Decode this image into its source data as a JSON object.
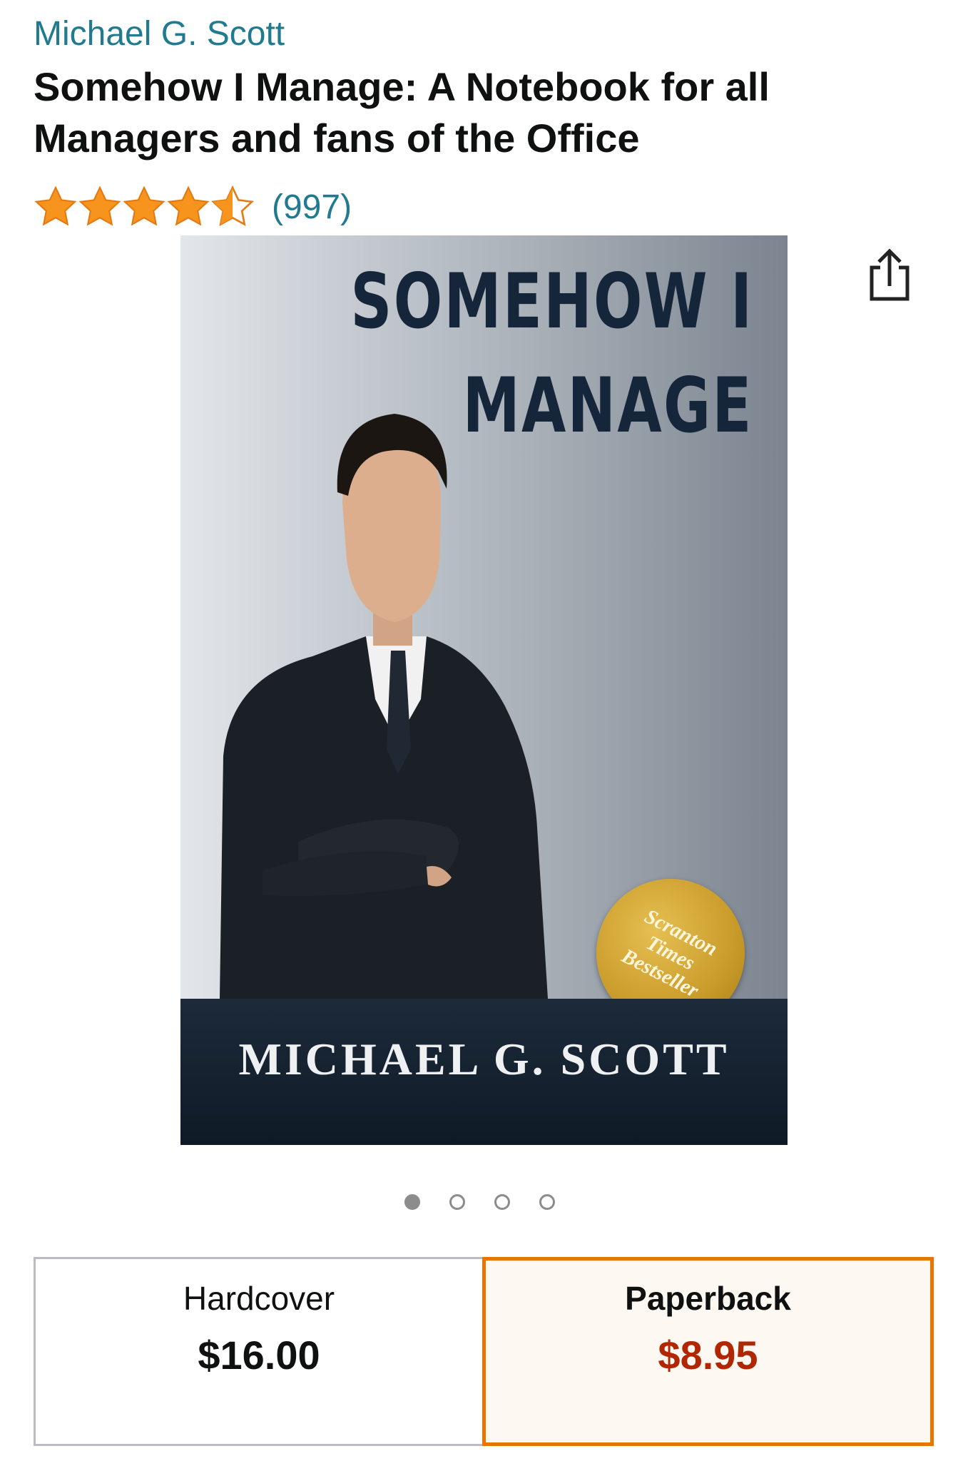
{
  "product": {
    "author": "Michael G. Scott",
    "title": "Somehow I Manage: A Notebook for all Managers and fans of the Office",
    "rating_value": 4.5,
    "rating_count": "(997)"
  },
  "cover": {
    "title_line1": "SOMEHOW I",
    "title_line2": "MANAGE",
    "author": "MICHAEL G. SCOTT",
    "seal_line1": "Scranton",
    "seal_line2": "Times",
    "seal_line3": "Bestseller"
  },
  "carousel": {
    "total": 4,
    "active": 1
  },
  "formats": [
    {
      "name": "Hardcover",
      "price": "$16.00",
      "selected": false
    },
    {
      "name": "Paperback",
      "price": "$8.95",
      "selected": true
    }
  ],
  "colors": {
    "link": "#217a8f",
    "star": "#f7941d",
    "selected_border": "#e77600",
    "sale_price": "#b12704"
  },
  "icons": {
    "share": "share-icon",
    "star": "star-icon"
  }
}
